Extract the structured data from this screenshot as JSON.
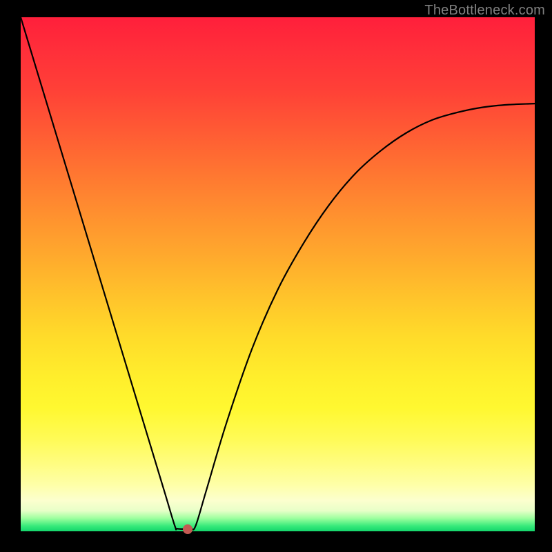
{
  "watermark": "TheBottleneck.com",
  "colors": {
    "frame": "#000000",
    "curve": "#000000",
    "marker": "#c45a53"
  },
  "chart_data": {
    "type": "line",
    "title": "",
    "xlabel": "",
    "ylabel": "",
    "xlim": [
      0,
      1
    ],
    "ylim": [
      0,
      1
    ],
    "x": [
      0.0,
      0.05,
      0.1,
      0.15,
      0.2,
      0.25,
      0.28,
      0.3,
      0.305,
      0.33,
      0.34,
      0.36,
      0.4,
      0.45,
      0.5,
      0.55,
      0.6,
      0.65,
      0.7,
      0.75,
      0.8,
      0.85,
      0.9,
      0.95,
      1.0
    ],
    "values": [
      1.0,
      0.835,
      0.67,
      0.505,
      0.34,
      0.175,
      0.076,
      0.01,
      0.005,
      0.005,
      0.01,
      0.076,
      0.21,
      0.355,
      0.47,
      0.56,
      0.635,
      0.695,
      0.74,
      0.775,
      0.8,
      0.815,
      0.825,
      0.83,
      0.832
    ],
    "marker": {
      "x": 0.325,
      "y": 0.0
    },
    "annotations": []
  }
}
